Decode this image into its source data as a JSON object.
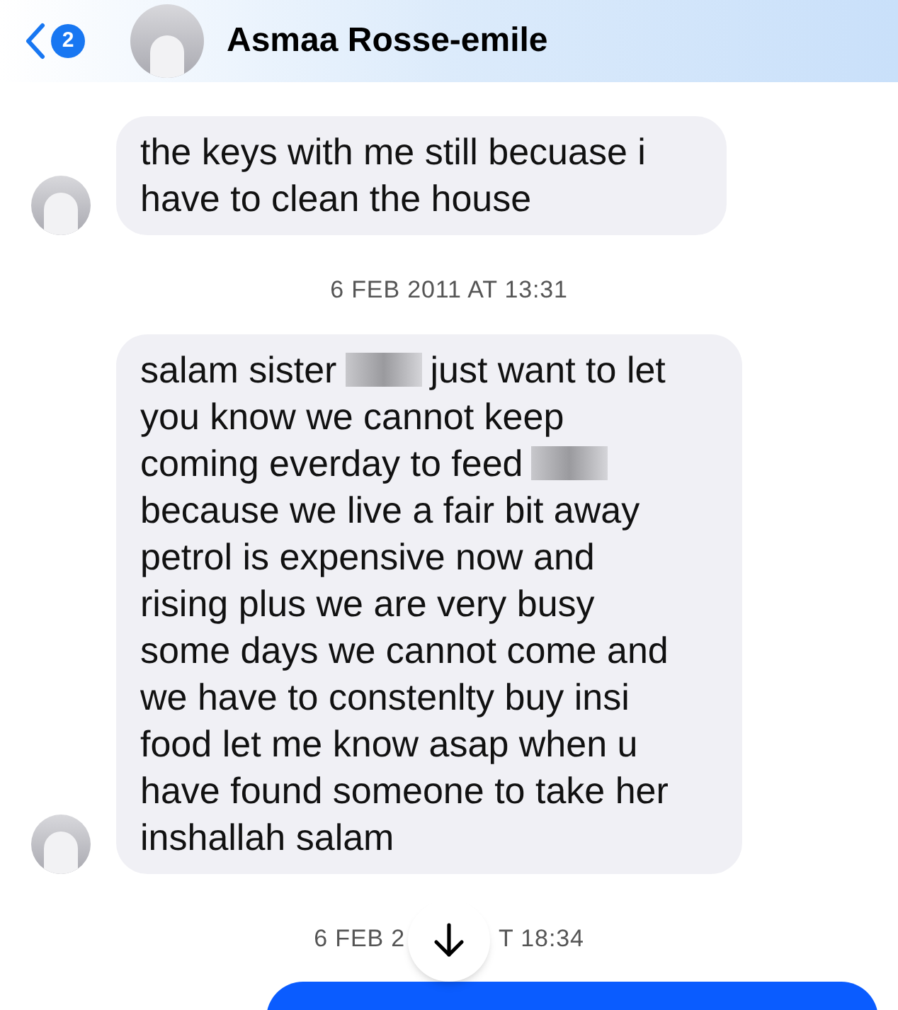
{
  "header": {
    "unread_count": "2",
    "contact_name": "Asmaa Rosse-emile"
  },
  "messages": [
    {
      "kind": "text",
      "parts": [
        {
          "kind": "text",
          "text": "the keys with me still becuase i have to clean the house"
        }
      ]
    },
    {
      "kind": "timestamp",
      "text": "6 FEB 2011 AT 13:31"
    },
    {
      "kind": "lines",
      "lines": [
        [
          {
            "kind": "text",
            "text": "salam sister"
          },
          {
            "kind": "redacted"
          },
          {
            "kind": "text",
            "text": "just want to let"
          }
        ],
        [
          {
            "kind": "text",
            "text": "you know we cannot keep"
          }
        ],
        [
          {
            "kind": "text",
            "text": "coming everday to feed"
          },
          {
            "kind": "redacted"
          }
        ],
        [
          {
            "kind": "text",
            "text": "because we live a fair bit away"
          }
        ],
        [
          {
            "kind": "text",
            "text": "petrol is expensive now and"
          }
        ],
        [
          {
            "kind": "text",
            "text": "rising plus we are very busy"
          }
        ],
        [
          {
            "kind": "text",
            "text": "some days we cannot come and"
          }
        ],
        [
          {
            "kind": "text",
            "text": "we have to constenlty buy insi"
          }
        ],
        [
          {
            "kind": "text",
            "text": "food let me know asap when u"
          }
        ],
        [
          {
            "kind": "text",
            "text": "have found someone to take her"
          }
        ],
        [
          {
            "kind": "text",
            "text": "inshallah salam"
          }
        ]
      ]
    },
    {
      "kind": "split_timestamp",
      "parts": [
        "6 FEB 2",
        "T 18:34"
      ]
    },
    {
      "kind": "outgoing_cut"
    }
  ]
}
